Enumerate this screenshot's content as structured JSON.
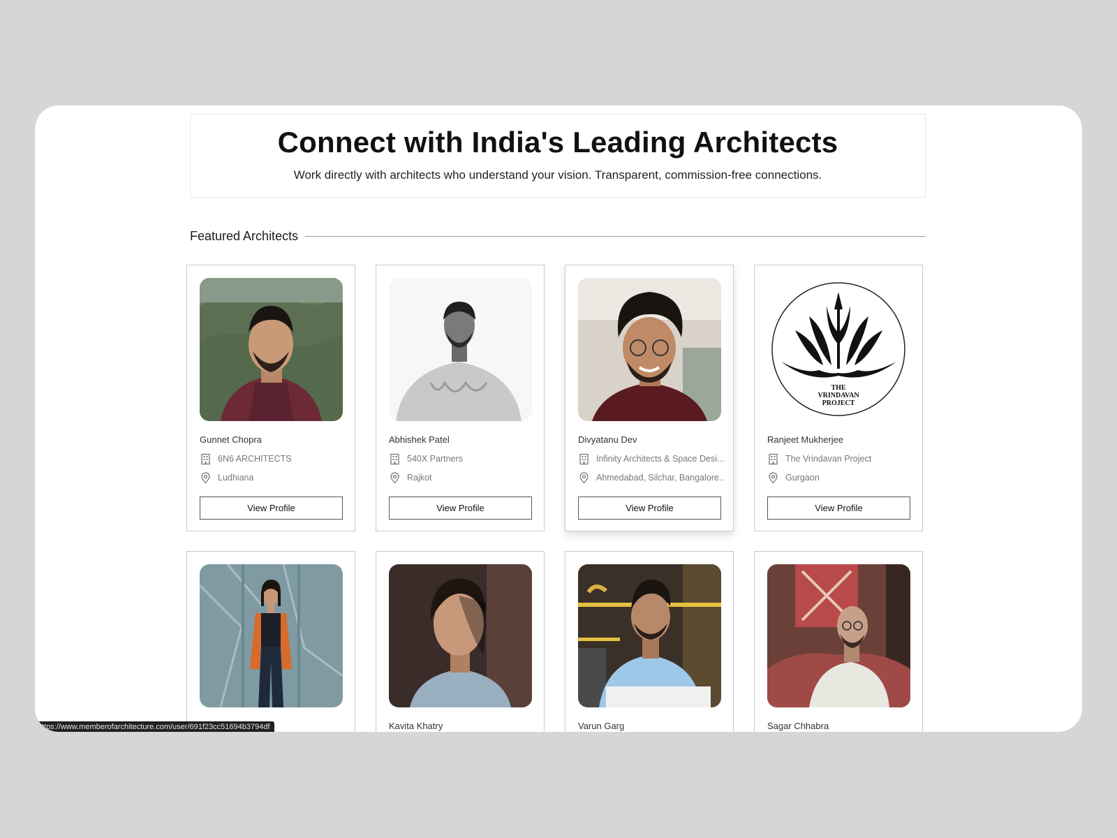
{
  "hero": {
    "title": "Connect with India's Leading Architects",
    "subtitle": "Work directly with architects who understand your vision. Transparent, commission-free connections."
  },
  "section": {
    "title": "Featured Architects"
  },
  "cards": [
    {
      "name": "Gunnet Chopra",
      "firm": "6N6 ARCHITECTS",
      "location": "Ludhiana",
      "button": "View Profile"
    },
    {
      "name": "Abhishek Patel",
      "firm": "540X Partners",
      "location": "Rajkot",
      "button": "View Profile"
    },
    {
      "name": "Divyatanu Dev",
      "firm": "Infinity Architects & Space Desi...",
      "location": "Ahmedabad, Silchar, Bangalore...",
      "button": "View Profile"
    },
    {
      "name": "Ranjeet Mukherjee",
      "firm": "The Vrindavan Project",
      "location": "Gurgaon",
      "button": "View Profile"
    },
    {
      "name": "",
      "firm": "",
      "location": "",
      "button": ""
    },
    {
      "name": "Kavita Khatry",
      "firm": "",
      "location": "",
      "button": ""
    },
    {
      "name": "Varun Garg",
      "firm": "",
      "location": "",
      "button": ""
    },
    {
      "name": "Sagar Chhabra",
      "firm": "",
      "location": "",
      "button": ""
    }
  ],
  "logo": {
    "line1": "THE",
    "line2": "VRINDAVAN",
    "line3": "PROJECT"
  },
  "status_bar": {
    "url": "ttps://www.memberofarchitecture.com/user/691f23cc51694b3794df"
  },
  "icons": {
    "firm": "building-icon",
    "location": "map-pin-icon"
  },
  "colors": {
    "page_bg": "#d6d6d6",
    "card_border": "#c9c9c9",
    "text": "#111111"
  }
}
